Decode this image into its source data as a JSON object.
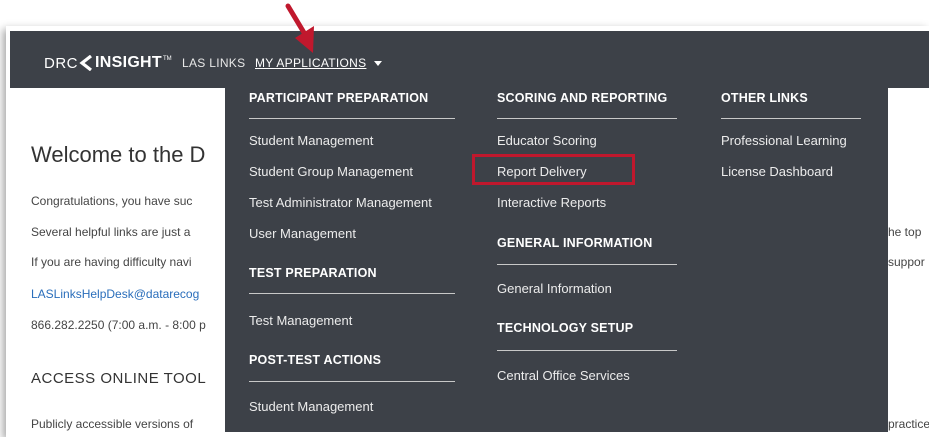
{
  "header": {
    "logo_drc": "DRC",
    "logo_insight": "INSIGHT",
    "logo_tm": "TM",
    "product": "LAS LINKS",
    "my_applications": "MY APPLICATIONS"
  },
  "background": {
    "welcome": "Welcome to the D",
    "lines": [
      "Congratulations, you have suc",
      "Several helpful links are just a",
      "If you are having difficulty navi",
      "LASLinksHelpDesk@datarecog",
      "866.282.2250 (7:00 a.m. - 8:00 p"
    ],
    "access": "ACCESS ONLINE TOOL",
    "last_line": "Publicly accessible versions of",
    "right_fragments": [
      "he top",
      "suppor",
      "practice"
    ]
  },
  "menu": {
    "participant_preparation": {
      "heading": "PARTICIPANT PREPARATION",
      "items": [
        "Student Management",
        "Student Group Management",
        "Test Administrator Management",
        "User Management"
      ]
    },
    "test_preparation": {
      "heading": "TEST PREPARATION",
      "items": [
        "Test Management"
      ]
    },
    "post_test_actions": {
      "heading": "POST-TEST ACTIONS",
      "items": [
        "Student Management"
      ]
    },
    "scoring_and_reporting": {
      "heading": "SCORING AND REPORTING",
      "items": [
        "Educator Scoring",
        "Report Delivery",
        "Interactive Reports"
      ]
    },
    "general_information": {
      "heading": "GENERAL INFORMATION",
      "items": [
        "General Information"
      ]
    },
    "technology_setup": {
      "heading": "TECHNOLOGY SETUP",
      "items": [
        "Central Office Services"
      ]
    },
    "other_links": {
      "heading": "OTHER LINKS",
      "items": [
        "Professional Learning",
        "License Dashboard"
      ]
    }
  },
  "colors": {
    "navbar": "#3d4148",
    "highlight": "#c0182d",
    "link": "#2a6ebb"
  }
}
